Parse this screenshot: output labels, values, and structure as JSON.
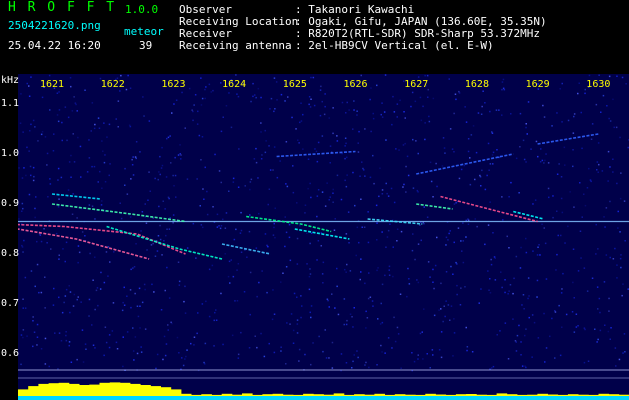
{
  "app": {
    "title": "H R O F F T",
    "version": "1.0.0"
  },
  "file": {
    "name": "2504221620.png",
    "timestamp": "25.04.22 16:20"
  },
  "meteor": {
    "label": "meteor",
    "count": "39"
  },
  "info": [
    {
      "label": "Observer",
      "value": ": Takanori Kawachi"
    },
    {
      "label": "Receiving Location",
      "value": ": Ogaki, Gifu, JAPAN (136.60E, 35.35N)"
    },
    {
      "label": "Receiver",
      "value": ": R820T2(RTL-SDR) SDR-Sharp 53.372MHz"
    },
    {
      "label": "Receiving antenna",
      "value": ": 2el-HB9CV Vertical (el. E-W)"
    }
  ],
  "colors": {
    "accent": "#00ff00",
    "cyan": "#00ffff",
    "time_labels": "#ffff00",
    "background": "#00004a",
    "level": "#ffff00"
  },
  "chart_data": {
    "type": "heatmap",
    "ylabel": "kHz",
    "ylim": [
      0.6,
      1.15
    ],
    "yticks": [
      "1.1",
      "1.0",
      "0.9",
      "0.8",
      "0.7",
      "0.6"
    ],
    "xticks": [
      "1621",
      "1622",
      "1623",
      "1624",
      "1625",
      "1626",
      "1627",
      "1628",
      "1629",
      "1630"
    ],
    "xlim": [
      1620.2,
      1630.2
    ],
    "carrier_khz": 0.865,
    "echoes": [
      {
        "x": [
          1620.2,
          1621.2,
          1622.4,
          1623.2
        ],
        "y": [
          0.86,
          0.855,
          0.84,
          0.8
        ],
        "color": "#ff5090"
      },
      {
        "x": [
          1620.2,
          1621.4,
          1622.6
        ],
        "y": [
          0.855,
          0.83,
          0.79
        ],
        "color": "#ff60a0"
      },
      {
        "x": [
          1621.9,
          1623.1,
          1623.8
        ],
        "y": [
          0.855,
          0.81,
          0.79
        ],
        "color": "#00ffcc"
      },
      {
        "x": [
          1621.0,
          1622.3,
          1623.2
        ],
        "y": [
          0.9,
          0.88,
          0.865
        ],
        "color": "#40ffb0"
      },
      {
        "x": [
          1621.0,
          1621.8
        ],
        "y": [
          0.92,
          0.91
        ],
        "color": "#00e0ff"
      },
      {
        "x": [
          1624.2,
          1625.1,
          1625.6
        ],
        "y": [
          0.875,
          0.86,
          0.845
        ],
        "color": "#00ff90"
      },
      {
        "x": [
          1625.0,
          1625.9
        ],
        "y": [
          0.85,
          0.83
        ],
        "color": "#00ffff"
      },
      {
        "x": [
          1623.8,
          1624.6
        ],
        "y": [
          0.82,
          0.8
        ],
        "color": "#40c0ff"
      },
      {
        "x": [
          1627.4,
          1628.2,
          1629.0
        ],
        "y": [
          0.915,
          0.89,
          0.865
        ],
        "color": "#ff5090"
      },
      {
        "x": [
          1628.6,
          1629.1
        ],
        "y": [
          0.885,
          0.87
        ],
        "color": "#00ffff"
      },
      {
        "x": [
          1627.0,
          1627.6
        ],
        "y": [
          0.9,
          0.89
        ],
        "color": "#40ffb0"
      },
      {
        "x": [
          1626.2,
          1627.1
        ],
        "y": [
          0.87,
          0.86
        ],
        "color": "#40e0ff"
      },
      {
        "x": [
          1627.0,
          1628.6
        ],
        "y": [
          0.96,
          1.0
        ],
        "color": "#3060ff"
      },
      {
        "x": [
          1624.7,
          1626.0
        ],
        "y": [
          0.995,
          1.005
        ],
        "color": "#3060ff"
      },
      {
        "x": [
          1629.0,
          1630.0
        ],
        "y": [
          1.02,
          1.04
        ],
        "color": "#3060ff"
      }
    ],
    "level": [
      0.3,
      0.45,
      0.55,
      0.58,
      0.6,
      0.55,
      0.5,
      0.52,
      0.6,
      0.62,
      0.6,
      0.55,
      0.5,
      0.45,
      0.4,
      0.3,
      0.1,
      0.05,
      0.08,
      0.05,
      0.1,
      0.06,
      0.12,
      0.05,
      0.08,
      0.1,
      0.06,
      0.05,
      0.1,
      0.08,
      0.06,
      0.12,
      0.05,
      0.08,
      0.06,
      0.1,
      0.05,
      0.08,
      0.06,
      0.05,
      0.1,
      0.07,
      0.05,
      0.08,
      0.09,
      0.06,
      0.05,
      0.12,
      0.08,
      0.05,
      0.06,
      0.1,
      0.07,
      0.05,
      0.08,
      0.06,
      0.05,
      0.1,
      0.08,
      0.06
    ]
  }
}
